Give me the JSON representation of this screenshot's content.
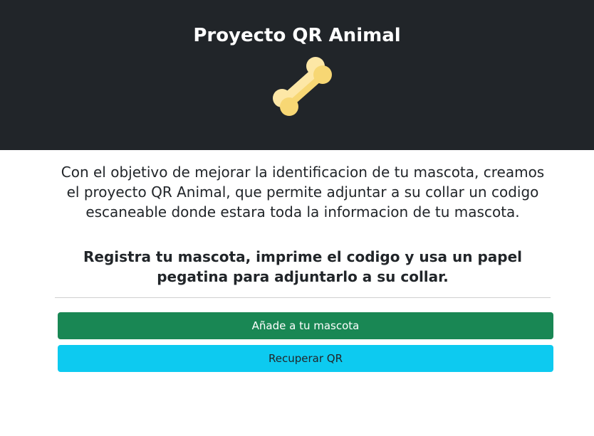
{
  "header": {
    "title": "Proyecto QR Animal",
    "logo_icon": "bone-icon",
    "background_color": "#212529"
  },
  "main": {
    "description": "Con el objetivo de mejorar la identificacion de tu mascota, creamos el proyecto QR Animal, que permite adjuntar a su collar un codigo escaneable donde estara toda la informacion de tu mascota.",
    "callout": "Registra tu mascota, imprime el codigo y usa un papel pegatina para adjuntarlo a su collar."
  },
  "actions": {
    "add_pet_label": "Añade a tu mascota",
    "add_pet_color": "#198754",
    "recover_qr_label": "Recuperar QR",
    "recover_qr_color": "#0dcaf0"
  }
}
